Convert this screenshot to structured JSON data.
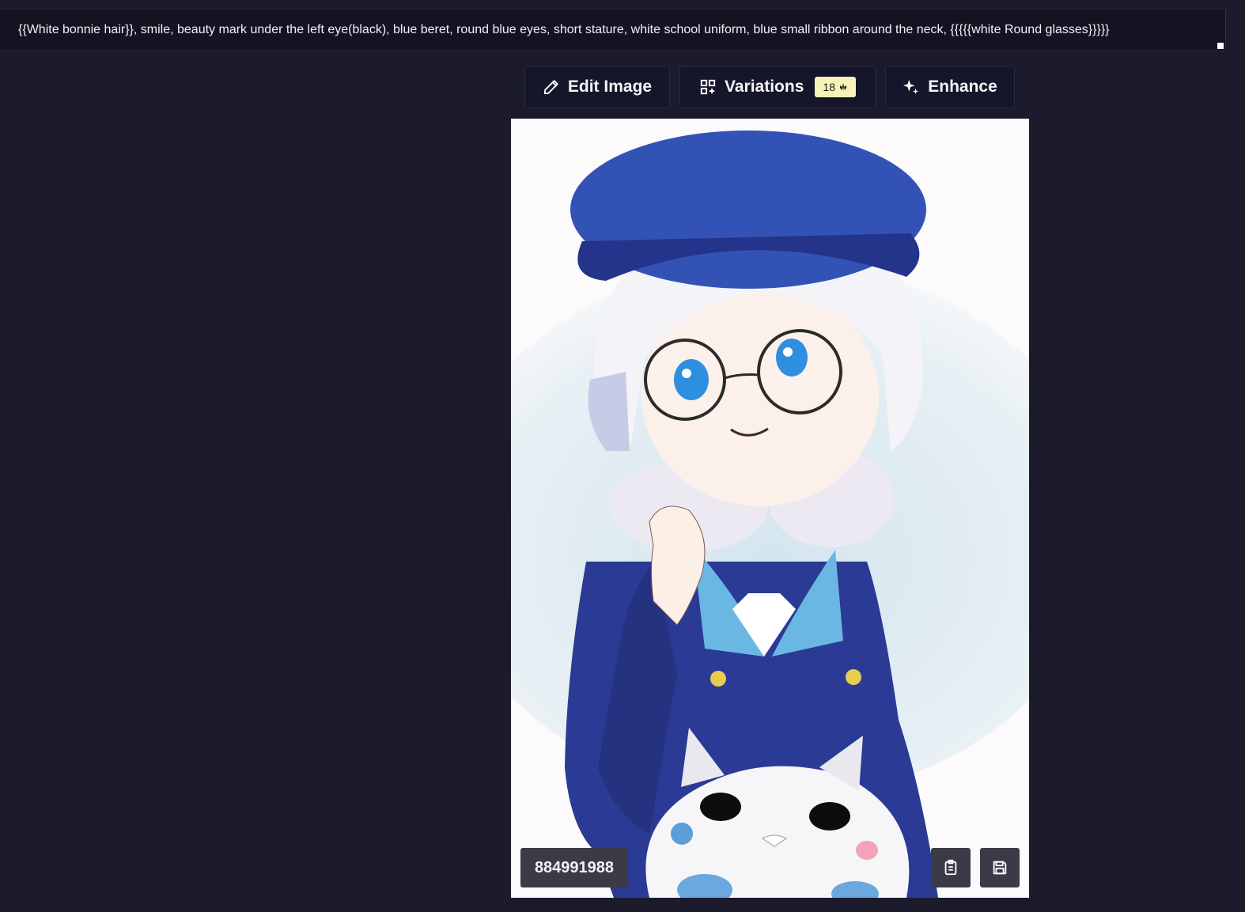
{
  "prompt": {
    "text": "{{White bonnie hair}}, smile, beauty mark under the left eye(black), blue beret, round blue eyes, short stature, white school uniform, blue small ribbon around the neck, {{{{{white Round glasses}}}}}"
  },
  "toolbar": {
    "edit_label": "Edit Image",
    "variations_label": "Variations",
    "variations_cost": "18",
    "enhance_label": "Enhance"
  },
  "image": {
    "seed": "884991988",
    "alt": "anime girl with white hair, blue beret and round glasses holding a white plush cat"
  },
  "icons": {
    "edit": "pencil-icon",
    "variations": "grid-plus-icon",
    "cost": "anlas-icon",
    "enhance": "sparkle-icon",
    "copy": "clipboard-icon",
    "save": "floppy-disk-icon"
  },
  "colors": {
    "background": "#1b1b2c",
    "prompt_bg": "#131322",
    "button_bg": "#16162a",
    "badge_bg": "#f7f3b9",
    "chip_bg": "#3a3b47"
  }
}
